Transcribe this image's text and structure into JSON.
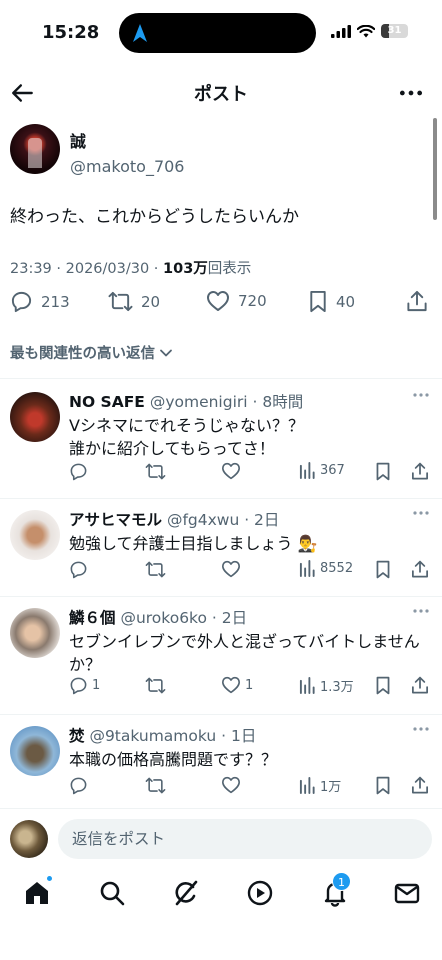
{
  "status_bar": {
    "time": "15:28",
    "battery": "31",
    "battery_level": 0.31
  },
  "header": {
    "title": "ポスト"
  },
  "post": {
    "display_name": "誠",
    "handle": "@makoto_706",
    "text": "終わった、これからどうしたらいんか",
    "timestamp": "23:39 · 2026/03/30 · ",
    "views_count": "103万",
    "views_label": "回表示",
    "replies": "213",
    "reposts": "20",
    "likes": "720",
    "bookmarks": "40"
  },
  "sort_label": "最も関連性の高い返信",
  "replies": [
    {
      "name": "NO SAFE",
      "sub": " @yomenigiri · 8時間",
      "text": "Vシネマにでれそうじゃない？？\n誰かに紹介してもらってさ！",
      "replies": "",
      "reposts": "",
      "likes": "",
      "views": "367"
    },
    {
      "name": "アサヒマモル",
      "sub": " @fg4xwu · 2日",
      "text": "勉強して弁護士目指しましょう 👨‍⚖️",
      "replies": "",
      "reposts": "",
      "likes": "",
      "views": "8552"
    },
    {
      "name": "鱗６個",
      "sub": " @uroko6ko · 2日",
      "text": "セブンイレブンで外人と混ざってバイトしませんか？",
      "replies": "1",
      "reposts": "",
      "likes": "1",
      "views": "1.3万"
    },
    {
      "name": "焚",
      "sub": " @9takumamoku · 1日",
      "text": "本職の価格高騰問題です？？",
      "replies": "",
      "reposts": "",
      "likes": "",
      "views": "1万"
    }
  ],
  "compose": {
    "placeholder": "返信をポスト"
  },
  "tabs": {
    "notifications_badge": "1"
  },
  "colors": {
    "accent": "#1d9bf0",
    "text": "#0f1419",
    "muted": "#536471"
  }
}
